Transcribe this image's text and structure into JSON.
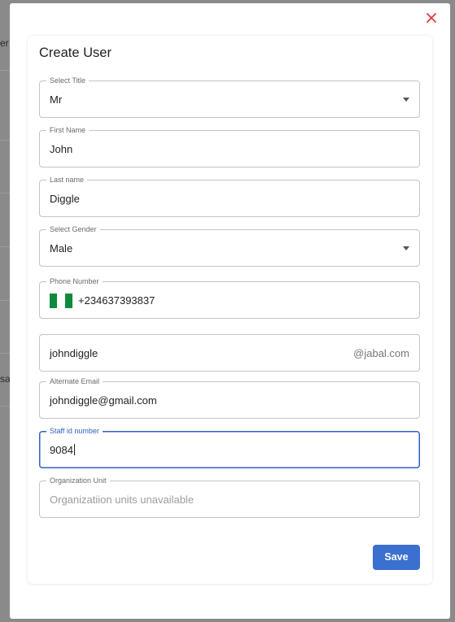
{
  "background": {
    "fragments": [
      "er",
      "sab"
    ]
  },
  "modal": {
    "title": "Create User",
    "close_icon": "close-icon",
    "accent_color": "#3b6fd0",
    "close_color": "#e0393b",
    "fields": {
      "title": {
        "label": "Select Title",
        "value": "Mr"
      },
      "first_name": {
        "label": "First Name",
        "value": "John"
      },
      "last_name": {
        "label": "Last name",
        "value": "Diggle"
      },
      "gender": {
        "label": "Select Gender",
        "value": "Male"
      },
      "phone": {
        "label": "Phone Number",
        "value": "+234637393837",
        "flag_colors": [
          "#0f8a3c",
          "#ffffff",
          "#0f8a3c"
        ]
      },
      "email": {
        "value": "johndiggle",
        "suffix": "@jabal.com"
      },
      "alternate_email": {
        "label": "Alternate Email",
        "value": "johndiggle@gmail.com"
      },
      "staff_id": {
        "label": "Staff id number",
        "value": "9084"
      },
      "organization_unit": {
        "label": "Organization Unit",
        "placeholder": "Organizatiion units unavailable"
      }
    },
    "save_label": "Save"
  }
}
